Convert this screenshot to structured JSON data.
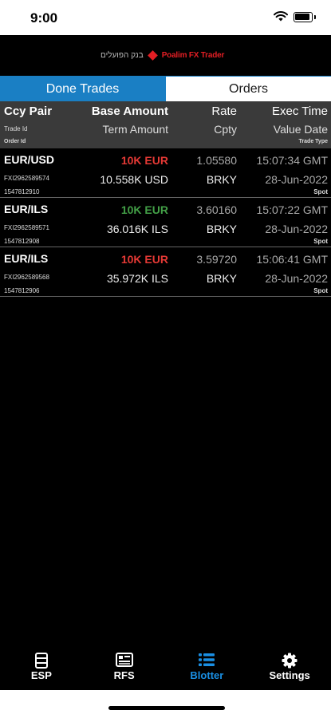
{
  "status_bar": {
    "time": "9:00"
  },
  "brand": {
    "hebrew": "בנק הפועלים",
    "name": "Poalim FX Trader",
    "accent": "#e31e24"
  },
  "segments": [
    {
      "label": "Done Trades",
      "active": true
    },
    {
      "label": "Orders",
      "active": false
    }
  ],
  "columns": {
    "ccy_pair": "Ccy Pair",
    "trade_id": "Trade Id",
    "order_id": "Order Id",
    "base_amount": "Base Amount",
    "term_amount": "Term Amount",
    "rate": "Rate",
    "cpty": "Cpty",
    "exec_time": "Exec Time",
    "value_date": "Value Date",
    "trade_type": "Trade Type"
  },
  "trades": [
    {
      "pair": "EUR/USD",
      "trade_id": "FXI2962589574",
      "order_id": "1547812910",
      "base_amount": "10K EUR",
      "base_color": "#e53935",
      "term_amount": "10.558K USD",
      "rate": "1.05580",
      "cpty": "BRKY",
      "exec_time": "15:07:34 GMT",
      "value_date": "28-Jun-2022",
      "trade_type": "Spot"
    },
    {
      "pair": "EUR/ILS",
      "trade_id": "FXI2962589571",
      "order_id": "1547812908",
      "base_amount": "10K EUR",
      "base_color": "#43a047",
      "term_amount": "36.016K ILS",
      "rate": "3.60160",
      "cpty": "BRKY",
      "exec_time": "15:07:22 GMT",
      "value_date": "28-Jun-2022",
      "trade_type": "Spot"
    },
    {
      "pair": "EUR/ILS",
      "trade_id": "FXI2962589568",
      "order_id": "1547812906",
      "base_amount": "10K EUR",
      "base_color": "#e53935",
      "term_amount": "35.972K ILS",
      "rate": "3.59720",
      "cpty": "BRKY",
      "exec_time": "15:06:41 GMT",
      "value_date": "28-Jun-2022",
      "trade_type": "Spot"
    }
  ],
  "tabs": [
    {
      "label": "ESP",
      "icon": "esp-icon",
      "active": false
    },
    {
      "label": "RFS",
      "icon": "rfs-icon",
      "active": false
    },
    {
      "label": "Blotter",
      "icon": "list-icon",
      "active": true
    },
    {
      "label": "Settings",
      "icon": "gear-icon",
      "active": false
    }
  ],
  "colors": {
    "tab_active": "#1a8fe3",
    "segment_active": "#1a7fc4"
  }
}
